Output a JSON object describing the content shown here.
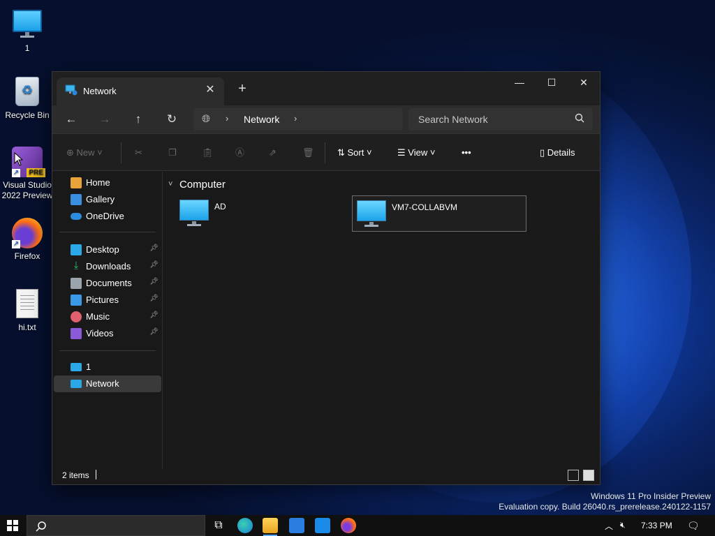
{
  "desktop": {
    "icons": [
      {
        "label": "1",
        "icon": "monitor-icon"
      },
      {
        "label": "Recycle Bin",
        "icon": "recycle-bin-icon"
      },
      {
        "label": "Visual Studio 2022 Preview",
        "badge": "PRE",
        "icon": "visual-studio-icon"
      },
      {
        "label": "Firefox",
        "icon": "firefox-icon"
      },
      {
        "label": "hi.txt",
        "icon": "text-file-icon"
      }
    ]
  },
  "window": {
    "tab_title": "Network",
    "address": {
      "crumb": "Network"
    },
    "search_placeholder": "Search Network",
    "toolbar": {
      "new_label": "New",
      "sort_label": "Sort",
      "view_label": "View",
      "more_label": "•••",
      "details_label": "Details"
    },
    "sidebar": {
      "top": [
        {
          "label": "Home",
          "icon": "home-icon",
          "color": "#e8a33a"
        },
        {
          "label": "Gallery",
          "icon": "gallery-icon",
          "color": "#3a8fe0"
        },
        {
          "label": "OneDrive",
          "icon": "onedrive-icon",
          "color": "#2b8de0"
        }
      ],
      "quick_access": [
        {
          "label": "Desktop",
          "icon": "desktop-icon",
          "color": "#2aa8e8"
        },
        {
          "label": "Downloads",
          "icon": "downloads-icon",
          "color": "#2cbf6a"
        },
        {
          "label": "Documents",
          "icon": "documents-icon",
          "color": "#9aa4ad"
        },
        {
          "label": "Pictures",
          "icon": "pictures-icon",
          "color": "#3a9ae8"
        },
        {
          "label": "Music",
          "icon": "music-icon",
          "color": "#e0606e"
        },
        {
          "label": "Videos",
          "icon": "videos-icon",
          "color": "#8a5ad8"
        }
      ],
      "bottom": [
        {
          "label": "1",
          "icon": "this-pc-icon",
          "color": "#2aa8e8"
        },
        {
          "label": "Network",
          "icon": "network-icon",
          "color": "#2aa8e8"
        }
      ]
    },
    "content": {
      "group": "Computer",
      "items": [
        {
          "name": "AD"
        },
        {
          "name": "VM7-COLLABVM"
        }
      ]
    },
    "status": "2 items"
  },
  "watermark": {
    "line1": "Windows 11 Pro Insider Preview",
    "line2": "Evaluation copy. Build 26040.rs_prerelease.240122-1157"
  },
  "taskbar": {
    "clock": "7:33 PM"
  }
}
